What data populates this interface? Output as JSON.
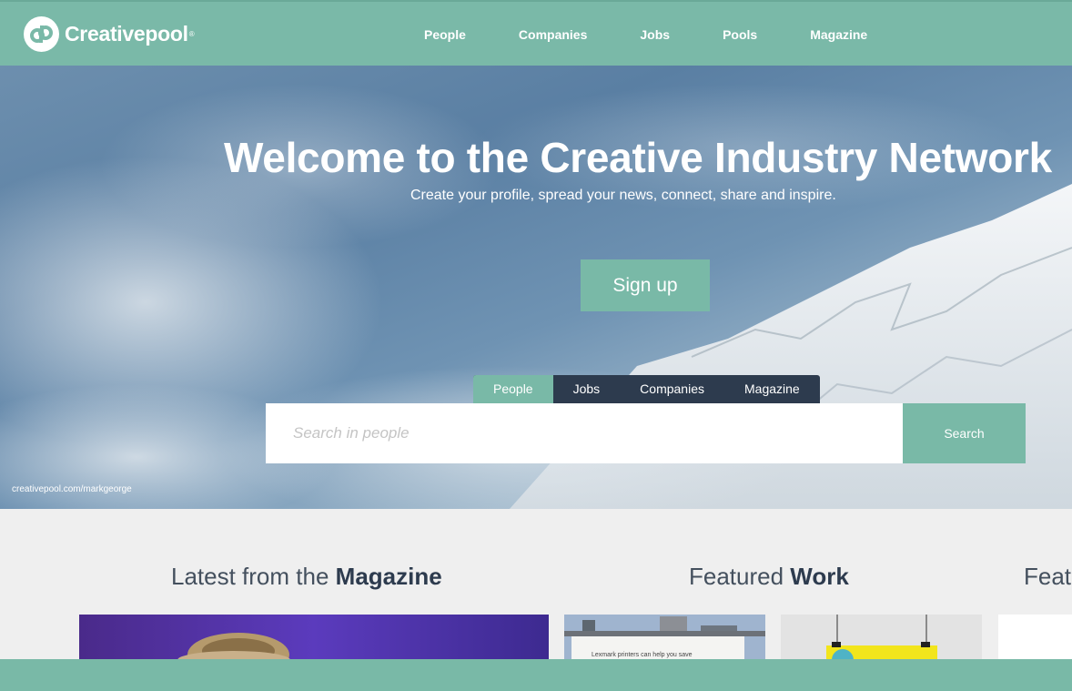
{
  "brand": {
    "name": "Creativepool",
    "reg": "®"
  },
  "nav": {
    "items": [
      "People",
      "Companies",
      "Jobs",
      "Pools",
      "Magazine"
    ]
  },
  "hero": {
    "title": "Welcome to the Creative Industry Network",
    "subtitle": "Create your profile, spread your news, connect, share and inspire.",
    "signup_label": "Sign up",
    "credit": "creativepool.com/markgeorge"
  },
  "search": {
    "tabs": [
      "People",
      "Jobs",
      "Companies",
      "Magazine"
    ],
    "active_tab": "People",
    "placeholder": "Search in people",
    "value": "",
    "button_label": "Search"
  },
  "sections": {
    "magazine": {
      "prefix": "Latest from the ",
      "strong": "Magazine"
    },
    "work": {
      "prefix": "Featured ",
      "strong": "Work"
    },
    "third": {
      "prefix": "Feat",
      "strong": ""
    }
  },
  "cards": {
    "billboard_text": "Lexmark printers can help you save"
  },
  "colors": {
    "accent": "#79b9a7",
    "dark": "#2d3b4e",
    "background": "#efefef"
  },
  "icons": {
    "logo": "creativepool-logo-icon"
  }
}
